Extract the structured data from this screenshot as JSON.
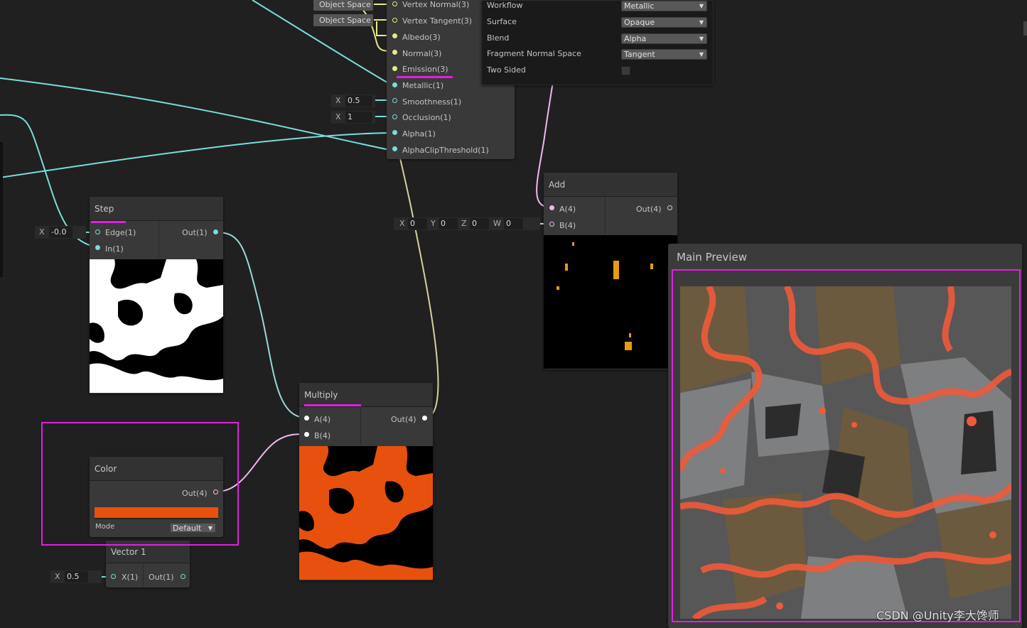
{
  "master_node": {
    "space_buttons": [
      "Object Space",
      "Object Space"
    ],
    "ports": [
      {
        "label": "Vertex Normal(3)"
      },
      {
        "label": "Vertex Tangent(3)"
      },
      {
        "label": "Albedo(3)"
      },
      {
        "label": "Normal(3)"
      },
      {
        "label": "Emission(3)"
      },
      {
        "label": "Metallic(1)"
      },
      {
        "label": "Smoothness(1)"
      },
      {
        "label": "Occlusion(1)"
      },
      {
        "label": "Alpha(1)"
      },
      {
        "label": "AlphaClipThreshold(1)"
      }
    ],
    "smoothness": {
      "axis": "X",
      "value": "0.5"
    },
    "occlusion": {
      "axis": "X",
      "value": "1"
    },
    "settings": [
      {
        "label": "Workflow",
        "value": "Metallic"
      },
      {
        "label": "Surface",
        "value": "Opaque"
      },
      {
        "label": "Blend",
        "value": "Alpha"
      },
      {
        "label": "Fragment Normal Space",
        "value": "Tangent"
      }
    ],
    "two_sided_label": "Two Sided"
  },
  "step_node": {
    "title": "Step",
    "edge_label": "Edge(1)",
    "in_label": "In(1)",
    "out_label": "Out(1)",
    "edge_field": {
      "axis": "X",
      "value": "-0.0"
    }
  },
  "add_node": {
    "title": "Add",
    "a_label": "A(4)",
    "b_label": "B(4)",
    "out_label": "Out(4)",
    "b_field": {
      "x_label": "X",
      "x": "0",
      "y_label": "Y",
      "y": "0",
      "z_label": "Z",
      "z": "0",
      "w_label": "W",
      "w": "0"
    }
  },
  "multiply_node": {
    "title": "Multiply",
    "a_label": "A(4)",
    "b_label": "B(4)",
    "out_label": "Out(4)"
  },
  "color_node": {
    "title": "Color",
    "out_label": "Out(4)",
    "mode_label": "Mode",
    "mode_value": "Default",
    "color_value": "#e8500e"
  },
  "vector1_node": {
    "title": "Vector 1",
    "x_label": "X(1)",
    "out_label": "Out(1)",
    "field": {
      "axis": "X",
      "value": "0.5"
    }
  },
  "main_preview": {
    "title": "Main Preview"
  },
  "watermark": "CSDN @Unity李大馋师",
  "colors": {
    "background": "#202020",
    "node_body": "#393939",
    "highlight": "#e020e0",
    "wire_float": "#7adcdc",
    "wire_vec3": "#e8e88a",
    "wire_vec4": "#f0b8f0",
    "accent_orange": "#e8500e"
  }
}
